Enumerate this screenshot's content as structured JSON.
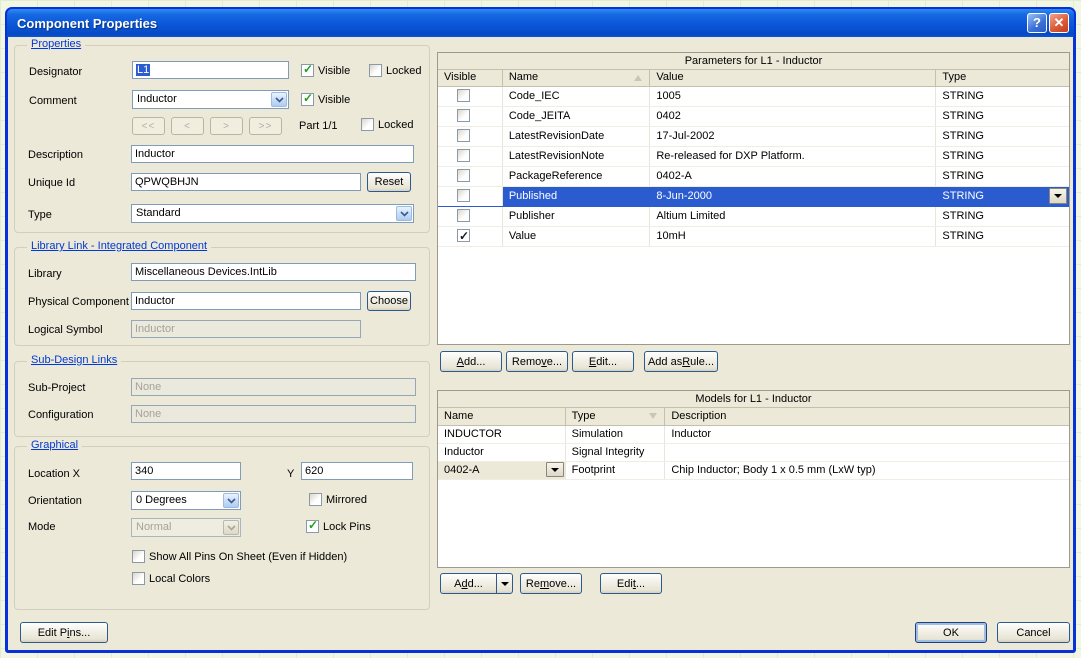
{
  "window": {
    "title": "Component Properties",
    "help_glyph": "?",
    "close_glyph": "✕"
  },
  "colors": {
    "selection": "#2A5BCF",
    "dialog_border": "#0831D9",
    "client_bg": "#ECE9D8",
    "titlebar_top": "#2E8CEF",
    "titlebar_bottom": "#0749C6",
    "section_title": "#0039D6",
    "check_green": "#1FA11F"
  },
  "properties": {
    "section_title": "Properties",
    "designator": {
      "label": "Designator",
      "value": "L1",
      "visible_label": "Visible",
      "visible_checked": true,
      "locked_label": "Locked",
      "locked_checked": false
    },
    "comment": {
      "label": "Comment",
      "value": "Inductor",
      "visible_label": "Visible",
      "visible_checked": true
    },
    "part_nav": {
      "first": "<<",
      "prev": "<",
      "next": ">",
      "last": ">>",
      "part_text": "Part 1/1",
      "locked_label": "Locked",
      "locked_checked": false
    },
    "description": {
      "label": "Description",
      "value": "Inductor"
    },
    "unique_id": {
      "label": "Unique Id",
      "value": "QPWQBHJN",
      "reset_label": "Reset"
    },
    "type": {
      "label": "Type",
      "value": "Standard"
    }
  },
  "library_link": {
    "section_title": "Library Link - Integrated Component",
    "library": {
      "label": "Library",
      "value": "Miscellaneous Devices.IntLib"
    },
    "physical_component": {
      "label": "Physical Component",
      "value": "Inductor",
      "choose_label": "Choose"
    },
    "logical_symbol": {
      "label": "Logical Symbol",
      "value": "Inductor"
    }
  },
  "sub_design": {
    "section_title": "Sub-Design Links",
    "sub_project": {
      "label": "Sub-Project",
      "value": "None"
    },
    "configuration": {
      "label": "Configuration",
      "value": "None"
    }
  },
  "graphical": {
    "section_title": "Graphical",
    "location_x_label": "Location X",
    "location_x": "340",
    "y_label": "Y",
    "location_y": "620",
    "orientation_label": "Orientation",
    "orientation_value": "0 Degrees",
    "mirrored_label": "Mirrored",
    "mirrored_checked": false,
    "mode_label": "Mode",
    "mode_value": "Normal",
    "lock_pins_label": "Lock Pins",
    "lock_pins_checked": true,
    "show_all_pins_label": "Show All Pins On Sheet (Even if Hidden)",
    "show_all_pins_checked": false,
    "local_colors_label": "Local Colors",
    "local_colors_checked": false
  },
  "parameters": {
    "title": "Parameters for L1 - Inductor",
    "columns": {
      "visible": "Visible",
      "name": "Name",
      "value": "Value",
      "type": "Type"
    },
    "sort": {
      "column": "Name",
      "direction": "asc"
    },
    "rows": [
      {
        "visible": false,
        "name": "Code_IEC",
        "value": "1005",
        "type": "STRING",
        "selected": false
      },
      {
        "visible": false,
        "name": "Code_JEITA",
        "value": "0402",
        "type": "STRING",
        "selected": false
      },
      {
        "visible": false,
        "name": "LatestRevisionDate",
        "value": "17-Jul-2002",
        "type": "STRING",
        "selected": false
      },
      {
        "visible": false,
        "name": "LatestRevisionNote",
        "value": "Re-released for DXP Platform.",
        "type": "STRING",
        "selected": false
      },
      {
        "visible": false,
        "name": "PackageReference",
        "value": "0402-A",
        "type": "STRING",
        "selected": false
      },
      {
        "visible": false,
        "name": "Published",
        "value": "8-Jun-2000",
        "type": "STRING",
        "selected": true
      },
      {
        "visible": false,
        "name": "Publisher",
        "value": "Altium Limited",
        "type": "STRING",
        "selected": false
      },
      {
        "visible": true,
        "name": "Value",
        "value": "10mH",
        "type": "STRING",
        "selected": false
      }
    ],
    "buttons": {
      "add": {
        "pre": "",
        "u": "A",
        "post": "dd..."
      },
      "remove": {
        "pre": "Remo",
        "u": "v",
        "post": "e..."
      },
      "edit": {
        "pre": "",
        "u": "E",
        "post": "dit..."
      },
      "add_as_rule": {
        "pre": "Add as ",
        "u": "R",
        "post": "ule..."
      }
    }
  },
  "models": {
    "title": "Models for L1 - Inductor",
    "columns": {
      "name": "Name",
      "type": "Type",
      "description": "Description"
    },
    "sort": {
      "column": "Type",
      "direction": "desc"
    },
    "rows": [
      {
        "name": "INDUCTOR",
        "type": "Simulation",
        "description": "Inductor",
        "combo": false
      },
      {
        "name": "Inductor",
        "type": "Signal Integrity",
        "description": "",
        "combo": false
      },
      {
        "name": "0402-A",
        "type": "Footprint",
        "description": "Chip Inductor; Body 1 x 0.5 mm (LxW typ)",
        "combo": true
      }
    ],
    "buttons": {
      "add": {
        "pre": "A",
        "u": "d",
        "post": "d..."
      },
      "remove": {
        "pre": "Re",
        "u": "m",
        "post": "ove..."
      },
      "edit": {
        "pre": "Edi",
        "u": "t",
        "post": "..."
      }
    }
  },
  "footer": {
    "edit_pins": {
      "pre": "Edit P",
      "u": "i",
      "post": "ns..."
    },
    "ok_label": "OK",
    "cancel_label": "Cancel"
  }
}
